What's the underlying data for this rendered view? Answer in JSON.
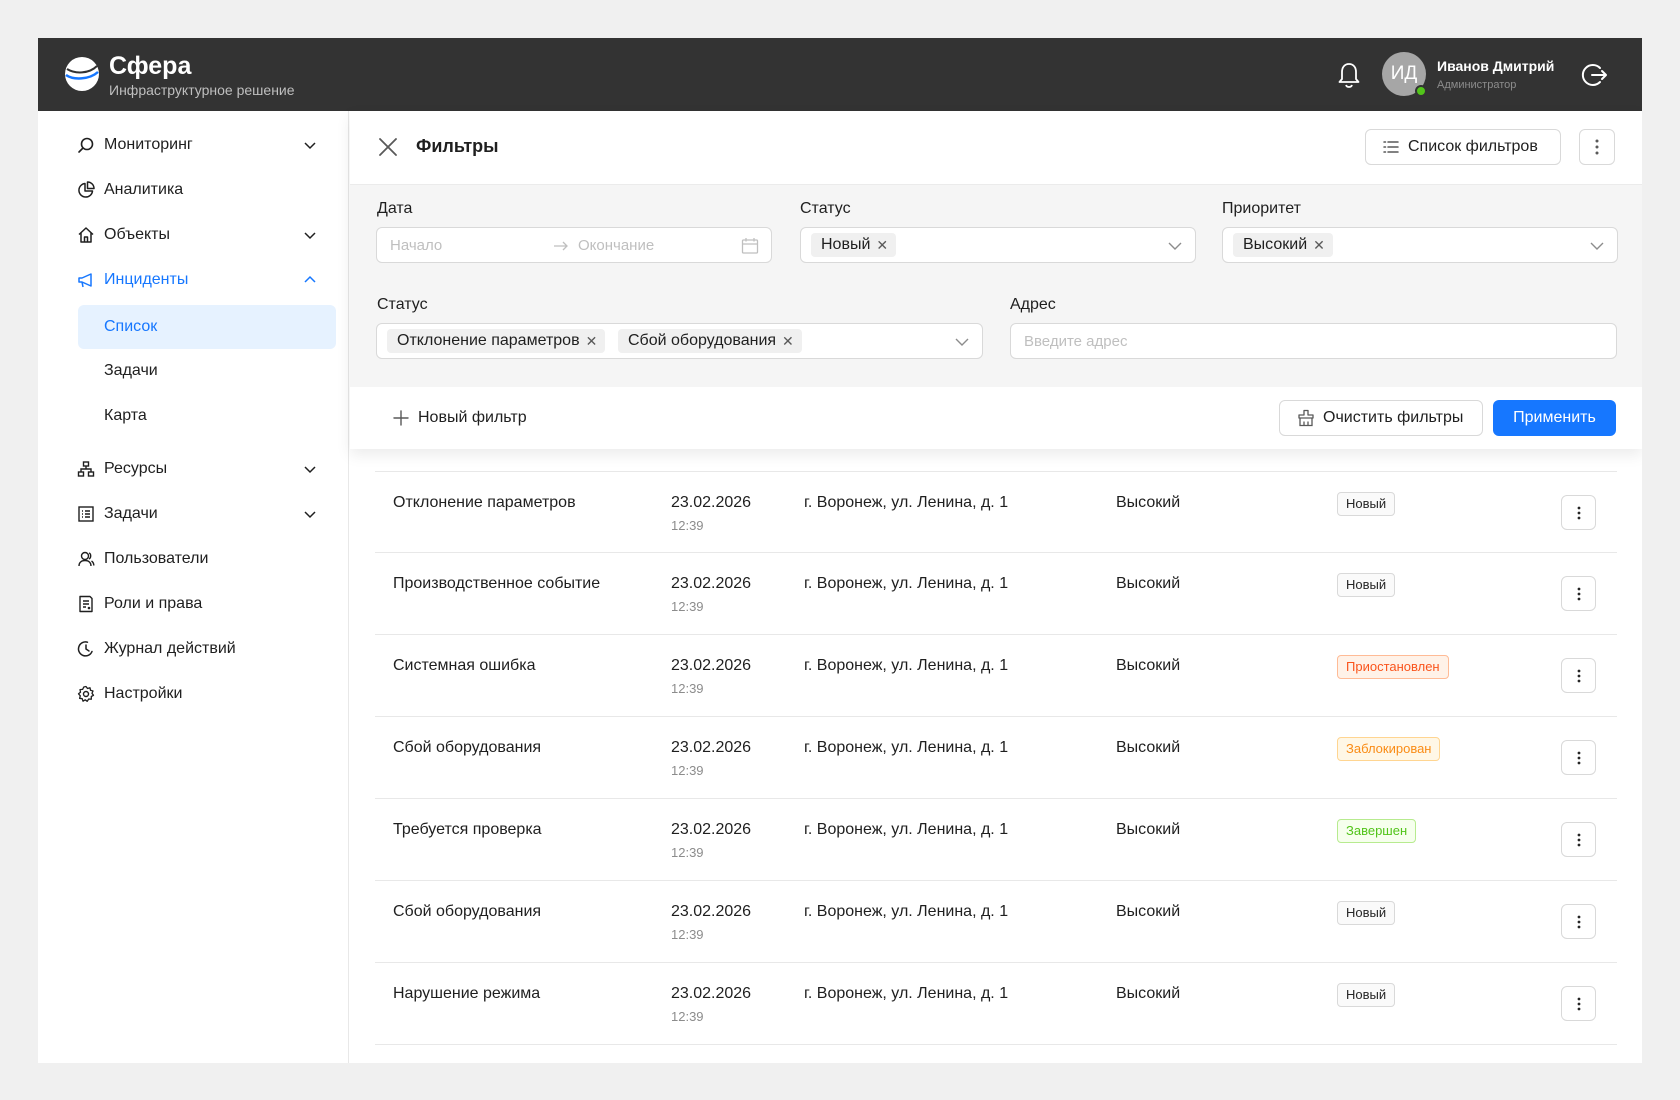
{
  "header": {
    "brand_name": "Сфера",
    "brand_subtitle": "Инфраструктурное решение",
    "user": {
      "initials": "ИД",
      "name": "Иванов Дмитрий",
      "role": "Администратор"
    }
  },
  "sidebar": {
    "items": [
      {
        "label": "Мониторинг",
        "icon": "search-icon",
        "has_chevron": true
      },
      {
        "label": "Аналитика",
        "icon": "pie-chart-icon",
        "has_chevron": false
      },
      {
        "label": "Объекты",
        "icon": "home-icon",
        "has_chevron": true
      },
      {
        "label": "Инциденты",
        "icon": "megaphone-icon",
        "has_chevron": true,
        "expanded": true,
        "active": true
      },
      {
        "label": "Ресурсы",
        "icon": "hierarchy-icon",
        "has_chevron": true
      },
      {
        "label": "Задачи",
        "icon": "list-icon",
        "has_chevron": true
      },
      {
        "label": "Пользователи",
        "icon": "users-icon",
        "has_chevron": false
      },
      {
        "label": "Роли и права",
        "icon": "document-icon",
        "has_chevron": false
      },
      {
        "label": "Журнал действий",
        "icon": "history-icon",
        "has_chevron": false
      },
      {
        "label": "Настройки",
        "icon": "gear-icon",
        "has_chevron": false
      }
    ],
    "incident_subitems": [
      {
        "label": "Список",
        "selected": true
      },
      {
        "label": "Задачи",
        "selected": false
      },
      {
        "label": "Карта",
        "selected": false
      }
    ]
  },
  "filters": {
    "title": "Фильтры",
    "list_button": "Список фильтров",
    "date": {
      "label": "Дата",
      "start_placeholder": "Начало",
      "end_placeholder": "Окончание"
    },
    "status1": {
      "label": "Статус",
      "tags": [
        "Новый"
      ]
    },
    "priority": {
      "label": "Приоритет",
      "tags": [
        "Высокий"
      ]
    },
    "status2": {
      "label": "Статус",
      "tags": [
        "Отклонение параметров",
        "Сбой оборудования"
      ]
    },
    "address": {
      "label": "Адрес",
      "placeholder": "Введите адрес"
    },
    "new_filter": "Новый фильтр",
    "clear_button": "Очистить фильтры",
    "apply_button": "Применить",
    "accent_color": "#1677ff"
  },
  "status_colors": {
    "Новый": {
      "bg": "#fafafa",
      "border": "#d9d9d9",
      "text": "#262626"
    },
    "Приостановлен": {
      "bg": "#fff2e8",
      "border": "#ffbb96",
      "text": "#fa541c"
    },
    "Заблокирован": {
      "bg": "#fff7e6",
      "border": "#ffd591",
      "text": "#fa8c16"
    },
    "Завершен": {
      "bg": "#f6ffed",
      "border": "#b7eb8f",
      "text": "#52c41a"
    }
  },
  "rows": [
    {
      "name": "Отклонение параметров",
      "date": "23.02.2026",
      "time": "12:39",
      "address": "г. Воронеж, ул. Ленина, д. 1",
      "priority": "Высокий",
      "status": "Новый"
    },
    {
      "name": "Производственное событие",
      "date": "23.02.2026",
      "time": "12:39",
      "address": "г. Воронеж, ул. Ленина, д. 1",
      "priority": "Высокий",
      "status": "Новый"
    },
    {
      "name": "Системная ошибка",
      "date": "23.02.2026",
      "time": "12:39",
      "address": "г. Воронеж, ул. Ленина, д. 1",
      "priority": "Высокий",
      "status": "Приостановлен"
    },
    {
      "name": "Сбой оборудования",
      "date": "23.02.2026",
      "time": "12:39",
      "address": "г. Воронеж, ул. Ленина, д. 1",
      "priority": "Высокий",
      "status": "Заблокирован"
    },
    {
      "name": "Требуется проверка",
      "date": "23.02.2026",
      "time": "12:39",
      "address": "г. Воронеж, ул. Ленина, д. 1",
      "priority": "Высокий",
      "status": "Завершен"
    },
    {
      "name": "Сбой оборудования",
      "date": "23.02.2026",
      "time": "12:39",
      "address": "г. Воронеж, ул. Ленина, д. 1",
      "priority": "Высокий",
      "status": "Новый"
    },
    {
      "name": "Нарушение режима",
      "date": "23.02.2026",
      "time": "12:39",
      "address": "г. Воронеж, ул. Ленина, д. 1",
      "priority": "Высокий",
      "status": "Новый"
    }
  ]
}
